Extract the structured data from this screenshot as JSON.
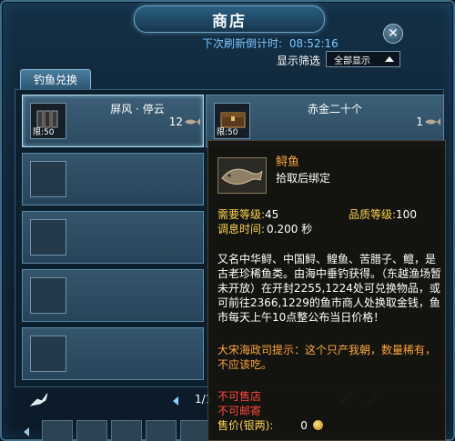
{
  "window": {
    "title": "商店"
  },
  "header": {
    "refresh_label": "下次刷新倒计时:",
    "refresh_time": "08:52:16",
    "filter_label": "显示筛选",
    "filter_value": "全部显示"
  },
  "tabs": [
    {
      "label": "钓鱼兑换"
    }
  ],
  "slots": [
    {
      "name": "屏风 · 停云",
      "count": "12",
      "limit": "限:50",
      "icon": "screen-icon"
    },
    {
      "name": "赤金二十个",
      "count": "1",
      "limit": "限:50",
      "icon": "gold-chest-icon"
    }
  ],
  "pager": {
    "text": "1/1"
  },
  "tooltip": {
    "name": "鲟鱼",
    "bind": "拾取后绑定",
    "req_level_label": "需要等级:",
    "req_level": "45",
    "quality_label": "品质等级:",
    "quality": "100",
    "cooldown_label": "调息时间:",
    "cooldown": "0.200 秒",
    "description": "又名中华鲟、中国鲟、鳇鱼、苦腊子、鳣，是古老珍稀鱼类。由海中垂钓获得。（东越渔场暂未开放）在开封2255,1224处可兑换物品，或可前往2366,1229的鱼市商人处换取金钱，鱼市每天上午10点整公布当日价格！",
    "hint": "大宋海政司提示：这个只产我朝，数量稀有，不应该吃。",
    "no_sell": "不可售店",
    "no_mail": "不可邮寄",
    "price_label": "售价(银两):",
    "price": "0"
  },
  "colors": {
    "accent_blue": "#7cc6ff",
    "orange": "#ffa834",
    "yellow": "#ffd54a",
    "red": "#ff4a3a"
  }
}
